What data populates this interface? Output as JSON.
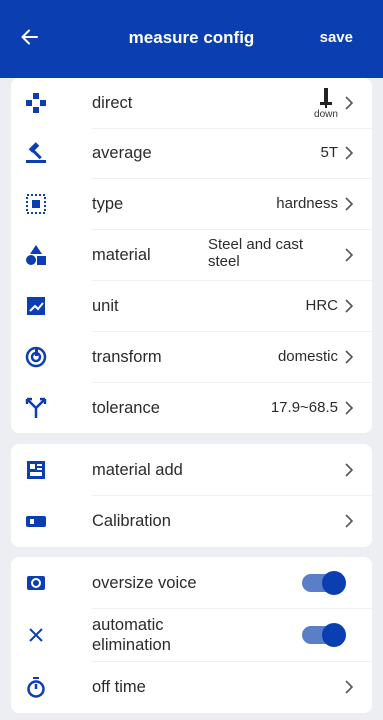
{
  "header": {
    "title": "measure config",
    "save_label": "save"
  },
  "config": {
    "direct": {
      "label": "direct",
      "value": "down",
      "icon": "gamepad-icon"
    },
    "average": {
      "label": "average",
      "value": "5T",
      "icon": "hammer-icon"
    },
    "type": {
      "label": "type",
      "value": "hardness",
      "icon": "frame-icon"
    },
    "material": {
      "label": "material",
      "value": "Steel and cast steel",
      "icon": "shapes-icon"
    },
    "unit": {
      "label": "unit",
      "value": "HRC",
      "icon": "chart-icon"
    },
    "transform": {
      "label": "transform",
      "value": "domestic",
      "icon": "transform-icon"
    },
    "tolerance": {
      "label": "tolerance",
      "value": "17.9~68.5",
      "icon": "split-icon"
    }
  },
  "tools": {
    "material_add": {
      "label": "material add",
      "icon": "grid-icon"
    },
    "calibration": {
      "label": "Calibration",
      "icon": "gauge-icon"
    }
  },
  "settings": {
    "oversize_voice": {
      "label": "oversize voice",
      "enabled": true,
      "icon": "speaker-icon"
    },
    "automatic_elimination": {
      "label": "automatic elimination",
      "enabled": true,
      "icon": "close-icon"
    },
    "off_time": {
      "label": "off time",
      "icon": "stopwatch-icon"
    }
  },
  "colors": {
    "primary": "#0b3fb1",
    "toggle_track": "#5b7fc6",
    "background": "#eceef2"
  }
}
